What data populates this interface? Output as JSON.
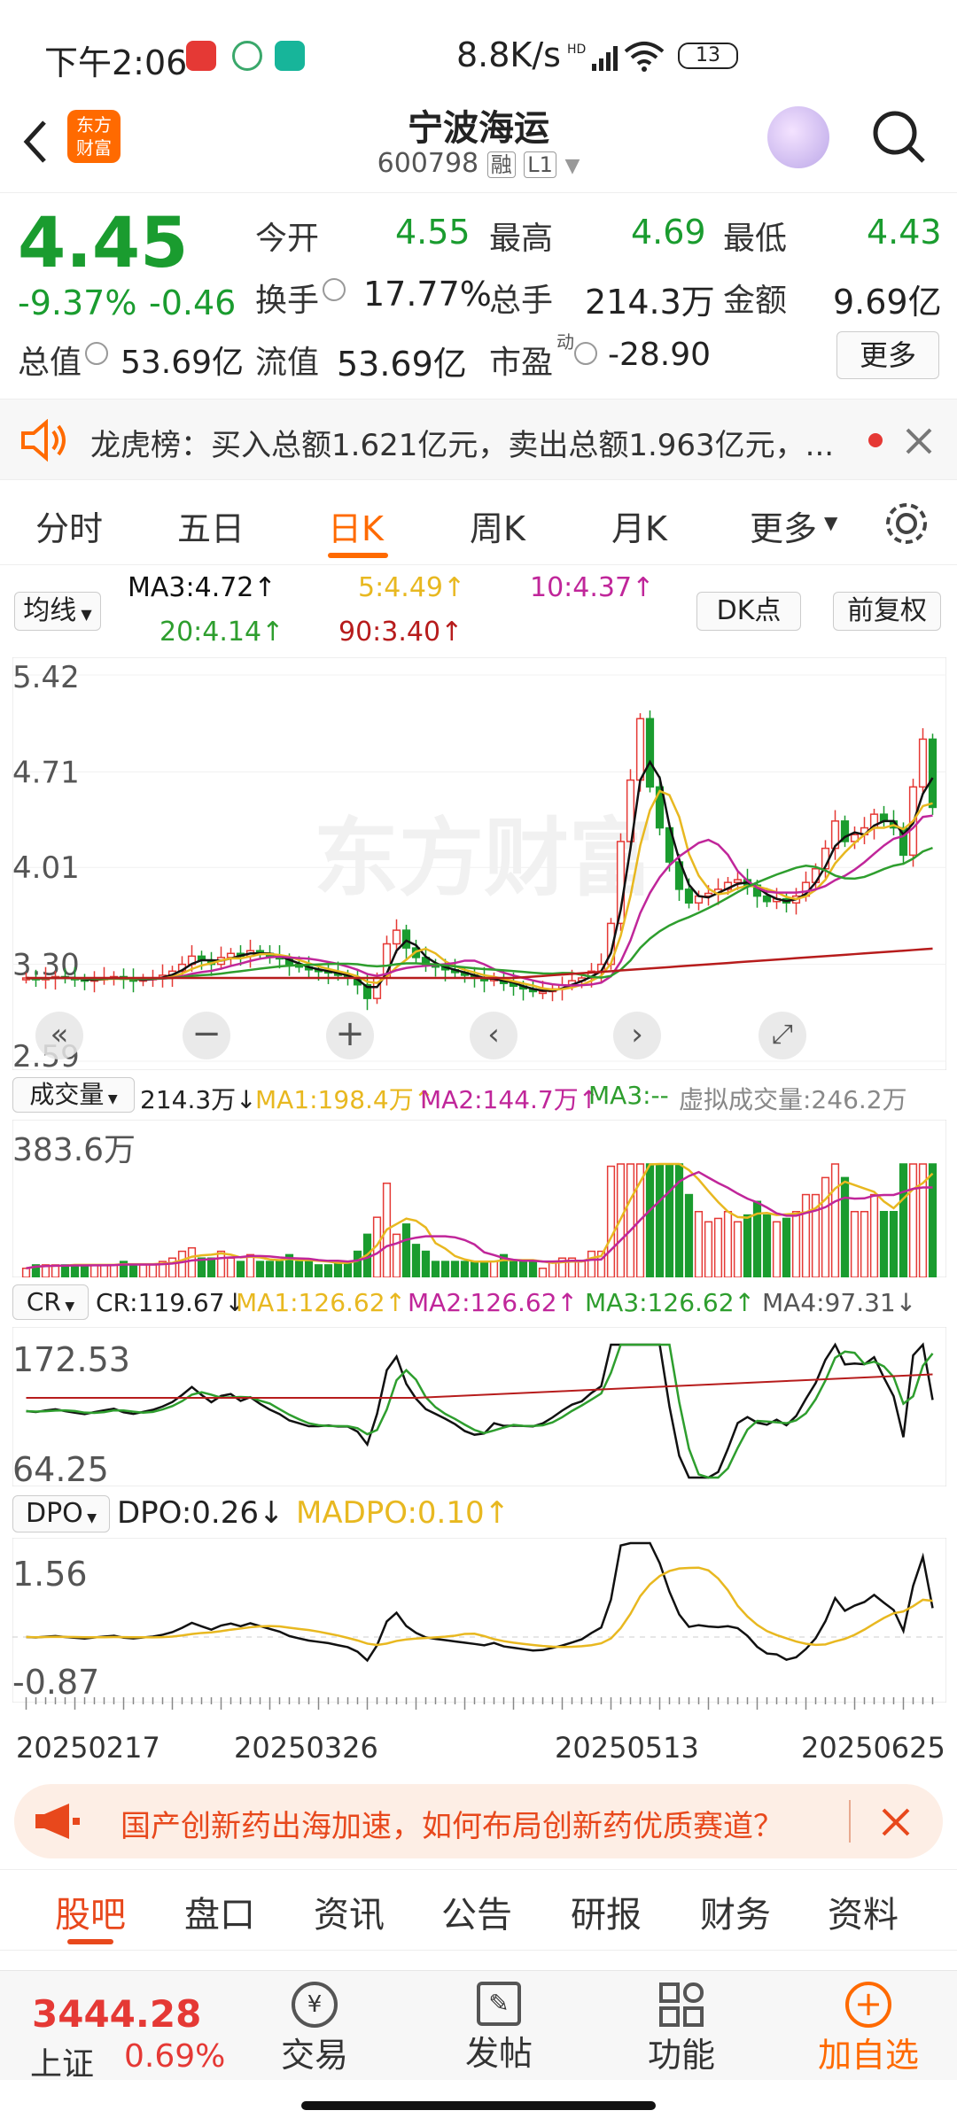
{
  "status_bar": {
    "time": "下午2:06",
    "speed": "8.8K/s",
    "battery": "13"
  },
  "header": {
    "back_icon": "chevron-left-icon",
    "logo_text": "东方财富",
    "title": "宁波海运",
    "code": "600798",
    "badge_rong": "融",
    "badge_level": "L1"
  },
  "quote": {
    "price": "4.45",
    "change_pct": "-9.37%",
    "change": "-0.46",
    "fields": {
      "open_label": "今开",
      "open_value": "4.55",
      "high_label": "最高",
      "high_value": "4.69",
      "low_label": "最低",
      "low_value": "4.43",
      "turnover_label": "换手",
      "turnover_value": "17.77%",
      "volume_label": "总手",
      "volume_value": "214.3万",
      "amount_label": "金额",
      "amount_value": "9.69亿",
      "mktcap_label": "总值",
      "mktcap_value": "53.69亿",
      "float_label": "流值",
      "float_value": "53.69亿",
      "pe_label": "市盈",
      "pe_sup": "动",
      "pe_value": "-28.90",
      "more_label": "更多"
    }
  },
  "notice": {
    "text": "龙虎榜：买入总额1.621亿元，卖出总额1.963亿元，..."
  },
  "chart_tabs": [
    "分时",
    "五日",
    "日K",
    "周K",
    "月K",
    "更多"
  ],
  "active_tab": "日K",
  "ma_legend": {
    "selector": "均线",
    "ma3": "MA3:4.72↑",
    "ma5": "5:4.49↑",
    "ma10": "10:4.37↑",
    "ma20": "20:4.14↑",
    "ma90": "90:3.40↑",
    "dk_label": "DK点",
    "adj_label": "前复权"
  },
  "colors": {
    "up": "#e53935",
    "down": "#1a9c2f",
    "ma3": "#111111",
    "ma5": "#e8b820",
    "ma10": "#c0269a",
    "ma20": "#2e9e2e",
    "ma90": "#b71c1c",
    "accent": "#ff6a00"
  },
  "chart_data": [
    {
      "type": "candlestick",
      "name": "日K",
      "yticks": [
        "5.42",
        "4.71",
        "4.01",
        "3.30",
        "2.59"
      ],
      "ylim": [
        2.59,
        5.42
      ],
      "close": [
        3.2,
        3.19,
        3.2,
        3.21,
        3.2,
        3.19,
        3.18,
        3.19,
        3.2,
        3.21,
        3.19,
        3.18,
        3.19,
        3.2,
        3.22,
        3.25,
        3.3,
        3.36,
        3.33,
        3.3,
        3.35,
        3.38,
        3.36,
        3.4,
        3.38,
        3.36,
        3.34,
        3.3,
        3.28,
        3.26,
        3.25,
        3.24,
        3.22,
        3.2,
        3.15,
        3.05,
        3.2,
        3.45,
        3.55,
        3.42,
        3.35,
        3.3,
        3.28,
        3.26,
        3.24,
        3.22,
        3.2,
        3.18,
        3.2,
        3.16,
        3.14,
        3.12,
        3.1,
        3.1,
        3.12,
        3.15,
        3.18,
        3.2,
        3.25,
        3.3,
        3.6,
        4.2,
        4.65,
        5.1,
        4.6,
        4.3,
        4.05,
        3.85,
        3.75,
        3.8,
        3.82,
        3.85,
        3.9,
        3.92,
        3.88,
        3.8,
        3.76,
        3.78,
        3.75,
        3.8,
        3.9,
        4.0,
        4.15,
        4.35,
        4.2,
        4.25,
        4.3,
        4.4,
        4.35,
        4.3,
        4.1,
        4.6,
        4.95,
        4.45
      ],
      "xticks": [
        "20250217",
        "20250326",
        "20250513",
        "20250625"
      ]
    },
    {
      "type": "bar",
      "name": "成交量",
      "selector": "成交量",
      "value_label": "214.3万↓",
      "ma1": "MA1:198.4万↑",
      "ma2": "MA2:144.7万↑",
      "ma3": "MA3:--",
      "virtual": "虚拟成交量:246.2万",
      "ymax_label": "383.6万"
    },
    {
      "type": "line",
      "name": "CR",
      "selector": "CR",
      "cr": "CR:119.67↓",
      "ma1": "MA1:126.62↑",
      "ma2": "MA2:126.62↑",
      "ma3": "MA3:126.62↑",
      "ma4": "MA4:97.31↓",
      "yticks": [
        "172.53",
        "64.25"
      ]
    },
    {
      "type": "line",
      "name": "DPO",
      "selector": "DPO",
      "dpo": "DPO:0.26↓",
      "madpo": "MADPO:0.10↑",
      "yticks": [
        "1.56",
        "-0.87"
      ]
    }
  ],
  "promo": {
    "text": "国产创新药出海加速，如何布局创新药优质赛道？"
  },
  "bottom_tabs": [
    "股吧",
    "盘口",
    "资讯",
    "公告",
    "研报",
    "财务",
    "资料"
  ],
  "active_bottom_tab": "股吧",
  "nav": {
    "index_value": "3444.28",
    "index_name": "上证",
    "index_change": "0.69%",
    "items": [
      "交易",
      "发帖",
      "功能",
      "加自选"
    ]
  },
  "watermark": "东方财富"
}
